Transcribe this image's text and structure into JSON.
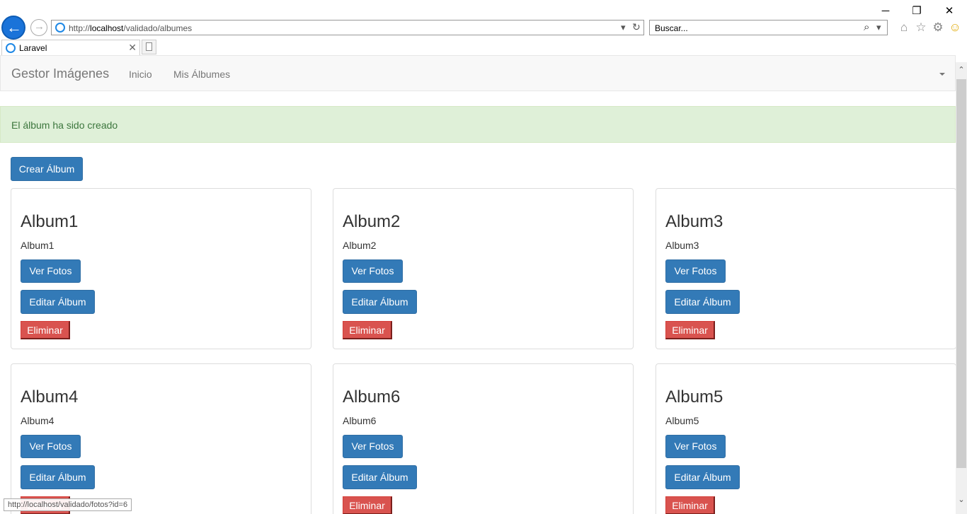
{
  "browser": {
    "url_prefix": "http://",
    "url_host": "localhost",
    "url_path": "/validado/albumes",
    "search_placeholder": "Buscar...",
    "tab_title": "Laravel",
    "status_url": "http://localhost/validado/fotos?id=6"
  },
  "icons": {
    "minimize": "─",
    "restore": "❐",
    "close": "✕",
    "tab_close": "✕",
    "dropdown": "▾",
    "refresh": "↻",
    "search": "⌕",
    "home": "⌂",
    "favorites": "☆",
    "settings": "⚙",
    "feedback": "☺",
    "back": "←",
    "forward": "→",
    "scroll_up": "⌃",
    "scroll_down": "⌄"
  },
  "navbar": {
    "brand": "Gestor Imágenes",
    "links": [
      "Inicio",
      "Mis Álbumes"
    ]
  },
  "alert": {
    "message": "El álbum ha sido creado"
  },
  "actions": {
    "create_label": "Crear Álbum"
  },
  "album_buttons": {
    "view": "Ver Fotos",
    "edit": "Editar Álbum",
    "delete": "Eliminar"
  },
  "albums": [
    {
      "title": "Album1",
      "description": "Album1"
    },
    {
      "title": "Album2",
      "description": "Album2"
    },
    {
      "title": "Album3",
      "description": "Album3"
    },
    {
      "title": "Album4",
      "description": "Album4"
    },
    {
      "title": "Album6",
      "description": "Album6"
    },
    {
      "title": "Album5",
      "description": "Album5"
    }
  ],
  "colors": {
    "primary": "#337ab7",
    "danger": "#d9534f",
    "success_bg": "#dff0d8",
    "success_text": "#3c763d",
    "ie_blue": "#1a73d9"
  }
}
